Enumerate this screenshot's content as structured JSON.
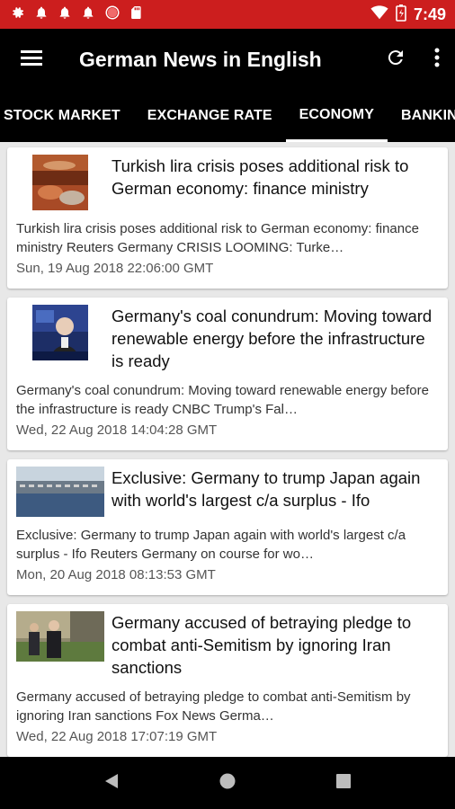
{
  "status_bar": {
    "time": "7:49",
    "icons": [
      "settings-icon",
      "bell-icon",
      "bell-icon",
      "bell-icon",
      "record-icon",
      "sd-card-icon",
      "wifi-icon",
      "battery-icon"
    ]
  },
  "app_bar": {
    "title": "German News in English",
    "icons": [
      "menu-icon",
      "refresh-icon",
      "more-vert-icon"
    ]
  },
  "tabs": [
    {
      "label": "STOCK MARKET"
    },
    {
      "label": "EXCHANGE RATE"
    },
    {
      "label": "ECONOMY"
    },
    {
      "label": "BANKING"
    }
  ],
  "active_tab": "ECONOMY",
  "articles": [
    {
      "title": "Turkish lira crisis poses additional risk to German economy: finance ministry",
      "description": "Turkish lira crisis poses additional risk to German economy: finance ministry  Reuters  Germany CRISIS LOOMING: Turke…",
      "date": "Sun, 19 Aug 2018 22:06:00 GMT",
      "thumbnail": "lira-crowd-photo"
    },
    {
      "title": "Germany's coal conundrum: Moving toward renewable energy before the infrastructure is ready",
      "description": "Germany's coal conundrum: Moving toward renewable energy before the infrastructure is ready  CNBC  Trump's Fal…",
      "date": "Wed, 22 Aug 2018 14:04:28 GMT",
      "thumbnail": "tv-interview-photo"
    },
    {
      "title": "Exclusive: Germany to trump Japan again with world's largest c/a surplus - Ifo",
      "description": "Exclusive: Germany to trump Japan again with world's largest c/a surplus - Ifo  Reuters  Germany on course for wo…",
      "date": "Mon, 20 Aug 2018 08:13:53 GMT",
      "thumbnail": "port-cars-photo"
    },
    {
      "title": "Germany accused of betraying pledge to combat anti-Semitism by ignoring Iran sanctions",
      "description": "Germany accused of betraying pledge to combat anti-Semitism by ignoring Iran sanctions  Fox News  Germa…",
      "date": "Wed, 22 Aug 2018 17:07:19 GMT",
      "thumbnail": "official-walking-photo"
    }
  ],
  "nav_bar": {
    "icons": [
      "back-icon",
      "home-icon",
      "recents-icon"
    ]
  },
  "colors": {
    "status_bar": "#cc1e1e",
    "app_bar": "#000000",
    "background": "#e8e8e8"
  }
}
